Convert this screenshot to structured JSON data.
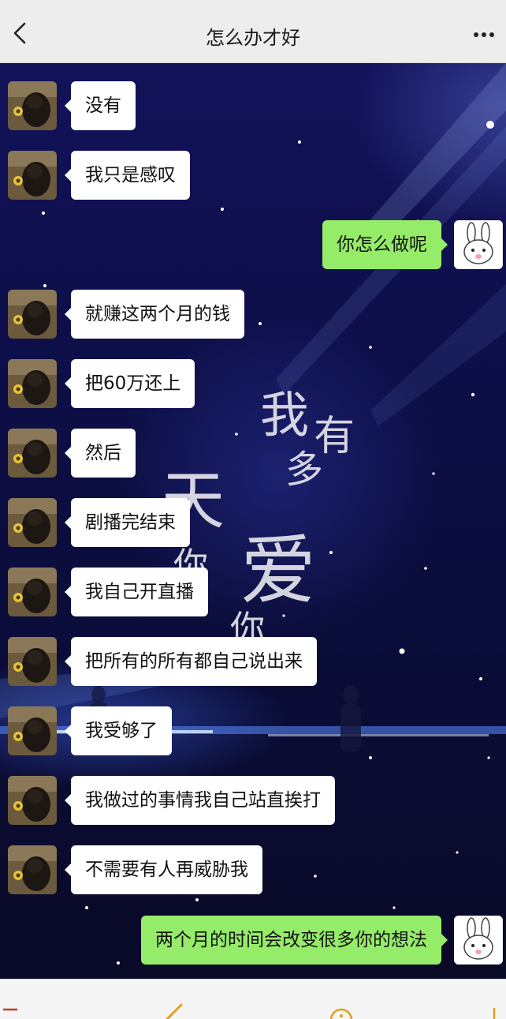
{
  "header": {
    "title": "怎么办才好",
    "back_icon": "chevron-left-icon",
    "more_icon": "more-dots-icon"
  },
  "background_lyrics": [
    "我",
    "有",
    "多",
    "爱",
    "天",
    "你",
    "你"
  ],
  "messages": [
    {
      "side": "left",
      "text": "没有"
    },
    {
      "side": "left",
      "text": "我只是感叹"
    },
    {
      "side": "right",
      "text": "你怎么做呢"
    },
    {
      "side": "left",
      "text": "就赚这两个月的钱"
    },
    {
      "side": "left",
      "text": "把60万还上"
    },
    {
      "side": "left",
      "text": "然后"
    },
    {
      "side": "left",
      "text": "剧播完结束"
    },
    {
      "side": "left",
      "text": "我自己开直播"
    },
    {
      "side": "left",
      "text": "把所有的所有都自己说出来"
    },
    {
      "side": "left",
      "text": "我受够了"
    },
    {
      "side": "left",
      "text": "我做过的事情我自己站直挨打"
    },
    {
      "side": "left",
      "text": "不需要有人再威胁我"
    },
    {
      "side": "right",
      "text": "两个月的时间会改变很多你的想法"
    }
  ],
  "colors": {
    "header_bg": "#ededed",
    "incoming_bubble": "#ffffff",
    "outgoing_bubble": "#95ec69",
    "chat_background": "#0c0e44"
  },
  "avatars": {
    "left": "dog-avatar",
    "right": "bunny-avatar"
  },
  "toolbar_icons": [
    "list-icon",
    "pen-icon",
    "smile-icon",
    "plus-icon"
  ]
}
